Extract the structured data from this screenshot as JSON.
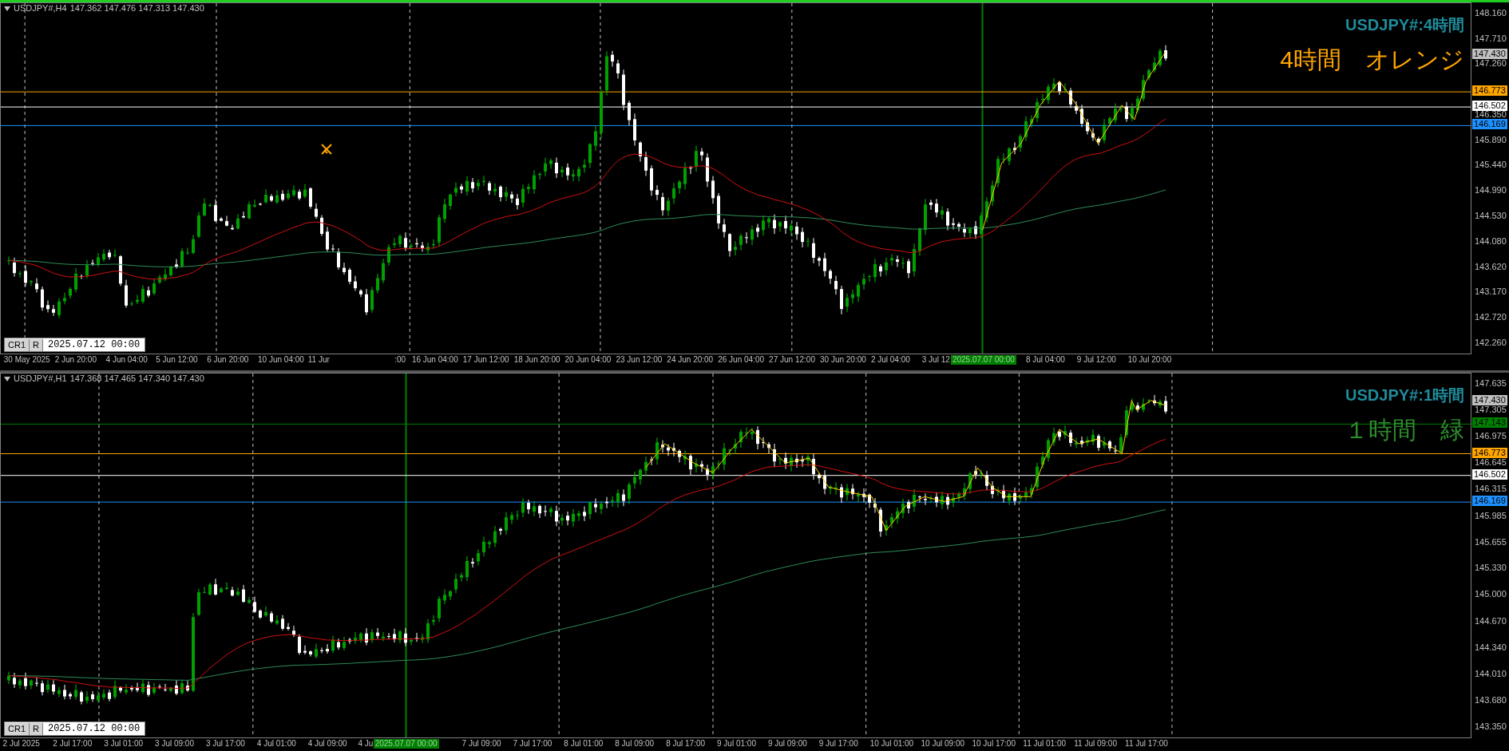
{
  "panes": [
    {
      "active": true,
      "symbol": "USDJPY#,H4",
      "prices": "147.362 147.476 147.313 147.430",
      "title": "USDJPY#:4時間",
      "note": "4時間　オレンジ",
      "price_ticks": [
        "148.160",
        "147.710",
        "147.260",
        "146.350",
        "145.890",
        "145.440",
        "144.990",
        "144.530",
        "144.080",
        "143.620",
        "143.170",
        "142.720",
        "142.260"
      ],
      "price_badges": [
        {
          "kind": "current",
          "text": "147.430",
          "color": "#c0c0c0"
        },
        {
          "kind": "level",
          "text": "146.773",
          "color": "#ffa500"
        },
        {
          "kind": "level",
          "text": "146.502",
          "color": "#ffffff"
        },
        {
          "kind": "level",
          "text": "146.169",
          "color": "#1e90ff"
        }
      ],
      "cursor_box": {
        "buttons": [
          "CR1",
          "R"
        ],
        "value": "2025.07.12 00:00"
      },
      "time_labels": [
        {
          "kind": "tick",
          "text": "30 May 2025"
        },
        {
          "kind": "tick",
          "text": "2 Jun 20:00"
        },
        {
          "kind": "tick",
          "text": "4 Jun 04:00"
        },
        {
          "kind": "tick",
          "text": "5 Jun 12:00"
        },
        {
          "kind": "tick",
          "text": "6 Jun 20:00"
        },
        {
          "kind": "tick",
          "text": "10 Jun 04:00"
        },
        {
          "kind": "tick",
          "text": "11 Jur"
        },
        {
          "kind": "tick",
          "text": ":00"
        },
        {
          "kind": "tick",
          "text": "16 Jun 04:00"
        },
        {
          "kind": "tick",
          "text": "17 Jun 12:00"
        },
        {
          "kind": "tick",
          "text": "18 Jun 20:00"
        },
        {
          "kind": "tick",
          "text": "20 Jun 04:00"
        },
        {
          "kind": "tick",
          "text": "23 Jun 12:00"
        },
        {
          "kind": "tick",
          "text": "24 Jun 20:00"
        },
        {
          "kind": "tick",
          "text": "26 Jun 04:00"
        },
        {
          "kind": "tick",
          "text": "27 Jun 12:00"
        },
        {
          "kind": "tick",
          "text": "30 Jun 20:00"
        },
        {
          "kind": "tick",
          "text": "2 Jul 04:00"
        },
        {
          "kind": "tick",
          "text": "3 Jul 12"
        },
        {
          "kind": "marker",
          "text": "2025.07.07 00:00"
        },
        {
          "kind": "tick",
          "text": "8 Jul 04:00"
        },
        {
          "kind": "tick",
          "text": "9 Jul 12:00"
        },
        {
          "kind": "tick",
          "text": "10 Jul 20:00"
        }
      ]
    },
    {
      "active": false,
      "symbol": "USDJPY#,H1",
      "prices": "147.368 147.465 147.340 147.430",
      "title": "USDJPY#:1時間",
      "note": "１時間　緑",
      "price_ticks": [
        "147.635",
        "147.305",
        "146.975",
        "146.645",
        "146.315",
        "145.985",
        "145.655",
        "145.330",
        "145.000",
        "144.670",
        "144.340",
        "144.010",
        "143.680",
        "143.350"
      ],
      "price_badges": [
        {
          "kind": "current",
          "text": "147.430",
          "color": "#c0c0c0"
        },
        {
          "kind": "level",
          "text": "147.143",
          "color": "#008000"
        },
        {
          "kind": "level",
          "text": "146.773",
          "color": "#ffa500"
        },
        {
          "kind": "level",
          "text": "146.502",
          "color": "#ffffff"
        },
        {
          "kind": "level",
          "text": "146.169",
          "color": "#1e90ff"
        }
      ],
      "cursor_box": {
        "buttons": [
          "CR1",
          "R"
        ],
        "value": "2025.07.12 00:00"
      },
      "time_labels": [
        {
          "kind": "tick",
          "text": "2 Jul 2025"
        },
        {
          "kind": "tick",
          "text": "2 Jul 17:00"
        },
        {
          "kind": "tick",
          "text": "3 Jul 01:00"
        },
        {
          "kind": "tick",
          "text": "3 Jul 09:00"
        },
        {
          "kind": "tick",
          "text": "3 Jul 17:00"
        },
        {
          "kind": "tick",
          "text": "4 Jul 01:00"
        },
        {
          "kind": "tick",
          "text": "4 Jul 09:00"
        },
        {
          "kind": "tick",
          "text": "4 Ju"
        },
        {
          "kind": "marker",
          "text": "2025.07.07 00:00"
        },
        {
          "kind": "tick",
          "text": "7 Jul 09:00"
        },
        {
          "kind": "tick",
          "text": "7 Jul 17:00"
        },
        {
          "kind": "tick",
          "text": "8 Jul 01:00"
        },
        {
          "kind": "tick",
          "text": "8 Jul 09:00"
        },
        {
          "kind": "tick",
          "text": "8 Jul 17:00"
        },
        {
          "kind": "tick",
          "text": "9 Jul 01:00"
        },
        {
          "kind": "tick",
          "text": "9 Jul 09:00"
        },
        {
          "kind": "tick",
          "text": "9 Jul 17:00"
        },
        {
          "kind": "tick",
          "text": "10 Jul 01:00"
        },
        {
          "kind": "tick",
          "text": "10 Jul 09:00"
        },
        {
          "kind": "tick",
          "text": "10 Jul 17:00"
        },
        {
          "kind": "tick",
          "text": "11 Jul 01:00"
        },
        {
          "kind": "tick",
          "text": "11 Jul 09:00"
        },
        {
          "kind": "tick",
          "text": "11 Jul 17:00"
        }
      ]
    }
  ]
}
